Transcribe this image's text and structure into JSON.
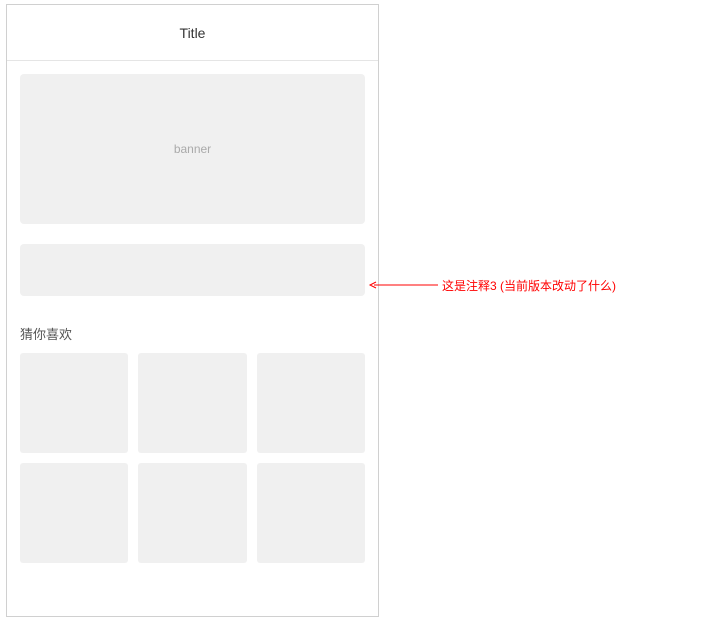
{
  "header": {
    "title": "Title"
  },
  "banner": {
    "label": "banner"
  },
  "section": {
    "title": "猜你喜欢"
  },
  "annotation": {
    "text": "这是注释3 (当前版本改动了什么)"
  },
  "colors": {
    "placeholder_bg": "#f0f0f0",
    "annotation": "#ff0000"
  }
}
